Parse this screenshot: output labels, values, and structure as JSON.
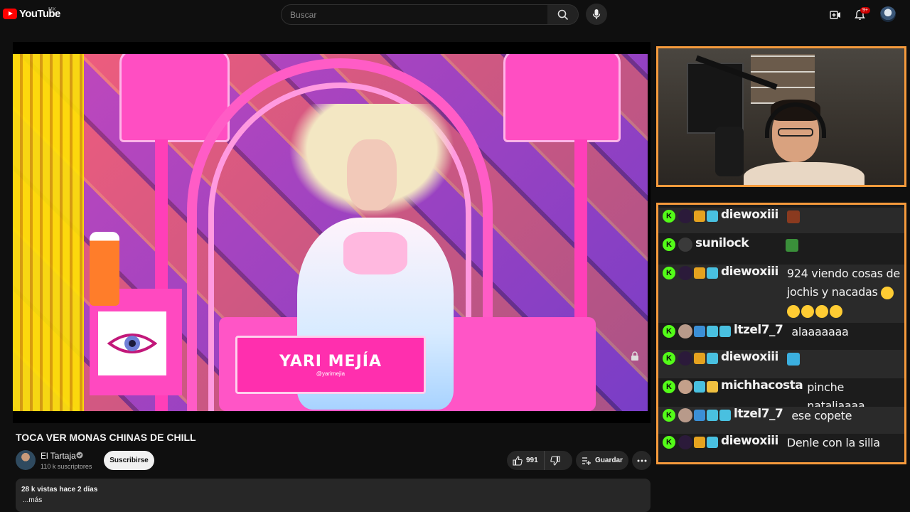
{
  "topbar": {
    "logo_text": "YouTube",
    "country": "MX",
    "search_placeholder": "Buscar",
    "notifications_badge": "9+",
    "icons": [
      "search-icon",
      "mic-icon",
      "create-icon",
      "bell-icon"
    ]
  },
  "video": {
    "overlay_name": "YARI MEJÍA",
    "overlay_handle": "@yarimejia"
  },
  "meta": {
    "title": "TOCA VER MONAS CHINAS DE CHILL",
    "channel_name": "El Tartaja",
    "subscribers": "110 k suscriptores",
    "subscribe_label": "Suscribirse",
    "like_count": "991",
    "save_label": "Guardar",
    "views_date": "28 k vistas  hace 2 días",
    "more_label": "...más"
  },
  "chat": {
    "messages": [
      {
        "user": "diewoxiii",
        "text": ""
      },
      {
        "user": "sunilock",
        "text": ""
      },
      {
        "user": "diewoxiii",
        "text": "924 viendo cosas de jochis y nacadas"
      },
      {
        "user": "ltzel7_7",
        "text": "alaaaaaaa"
      },
      {
        "user": "diewoxiii",
        "text": ""
      },
      {
        "user": "michhacosta",
        "text": "pinche nataliaaaa"
      },
      {
        "user": "ltzel7_7",
        "text": "ese copete"
      },
      {
        "user": "diewoxiii",
        "text": "Denle con la silla"
      }
    ]
  },
  "colors": {
    "accent_orange": "#f59a3c",
    "kick_green": "#53fc18",
    "youtube_red": "#ff0000"
  }
}
